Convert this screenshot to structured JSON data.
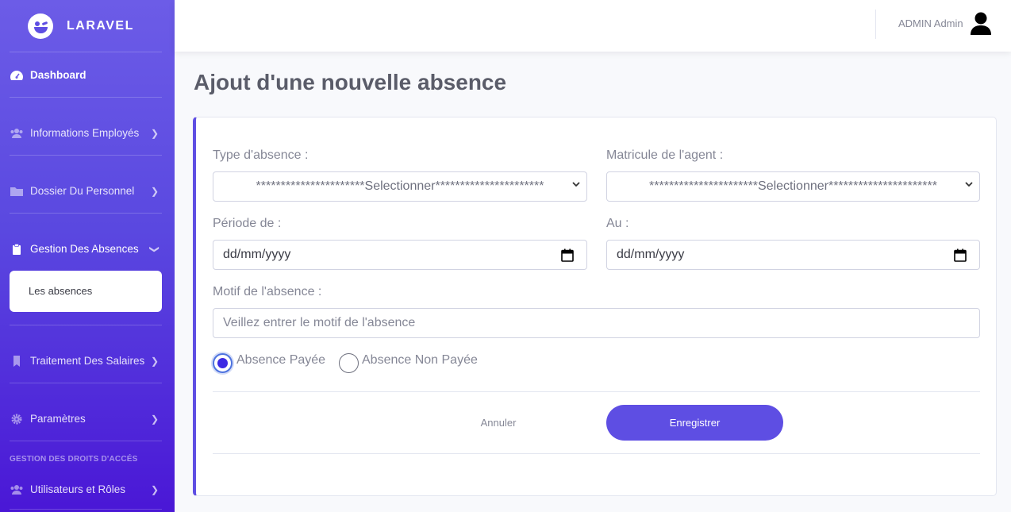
{
  "brand": {
    "name": "LARAVEL",
    "logo_icon": "smiley-wink-icon"
  },
  "sidebar": {
    "items": [
      {
        "label": "Dashboard",
        "icon": "dashboard-gauge-icon"
      },
      {
        "label": "Informations Employés",
        "icon": "users-icon"
      },
      {
        "label": "Dossier Du Personnel",
        "icon": "folder-icon"
      },
      {
        "label": "Gestion Des Absences",
        "icon": "clipboard-icon"
      },
      {
        "label": "Traitement Des Salaires",
        "icon": "bookmark-icon"
      },
      {
        "label": "Paramètres",
        "icon": "gear-icon"
      },
      {
        "label": "Utilisateurs et Rôles",
        "icon": "users-icon"
      }
    ],
    "submenu_item": "Les absences",
    "section_label": "GESTION DES DROITS D'ACCÉS"
  },
  "topbar": {
    "user_name": "ADMIN Admin",
    "user_icon": "user-icon"
  },
  "page": {
    "title": "Ajout d'une nouvelle absence"
  },
  "form": {
    "type_label": "Type d'absence :",
    "type_value": "**********************Selectionner**********************",
    "matricule_label": "Matricule de l'agent :",
    "matricule_value": "**********************Selectionner**********************",
    "periode_label": "Période de :",
    "periode_placeholder": "dd/mm/yyyy",
    "au_label": "Au :",
    "au_placeholder": "dd/mm/yyyy",
    "motif_label": "Motif de l'absence :",
    "motif_placeholder": "Veillez entrer le motif de l'absence",
    "radio_paid": "Absence Payée",
    "radio_unpaid": "Absence Non Payée",
    "selected_radio": "paid",
    "cancel_label": "Annuler",
    "save_label": "Enregistrer"
  },
  "colors": {
    "accent": "#5e4ee3",
    "sidebar_top": "#6c5ce7",
    "sidebar_bottom": "#4a17d6"
  }
}
